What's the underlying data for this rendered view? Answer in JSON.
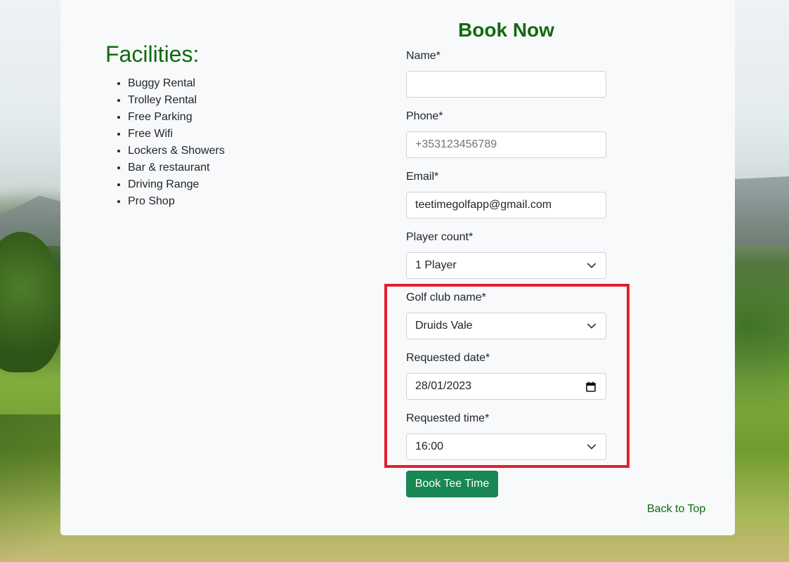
{
  "facilities": {
    "title": "Facilities:",
    "items": [
      "Buggy Rental",
      "Trolley Rental",
      "Free Parking",
      "Free Wifi",
      "Lockers & Showers",
      "Bar & restaurant",
      "Driving Range",
      "Pro Shop"
    ]
  },
  "booking": {
    "title": "Book Now",
    "name": {
      "label": "Name*",
      "value": ""
    },
    "phone": {
      "label": "Phone*",
      "placeholder": "+353123456789"
    },
    "email": {
      "label": "Email*",
      "value": "teetimegolfapp@gmail.com"
    },
    "player_count": {
      "label": "Player count*",
      "value": "1 Player"
    },
    "golf_club": {
      "label": "Golf club name*",
      "value": "Druids Vale"
    },
    "date": {
      "label": "Requested date*",
      "value": "28/01/2023"
    },
    "time": {
      "label": "Requested time*",
      "value": "16:00"
    },
    "submit_label": "Book Tee Time"
  },
  "footer": {
    "back_to_top": "Back to Top"
  },
  "colors": {
    "heading_green": "#0f6a0f",
    "button_green": "#198754",
    "highlight_red": "#e3202b"
  },
  "icons": {
    "select": "chevron-down-icon",
    "date": "calendar-icon"
  }
}
